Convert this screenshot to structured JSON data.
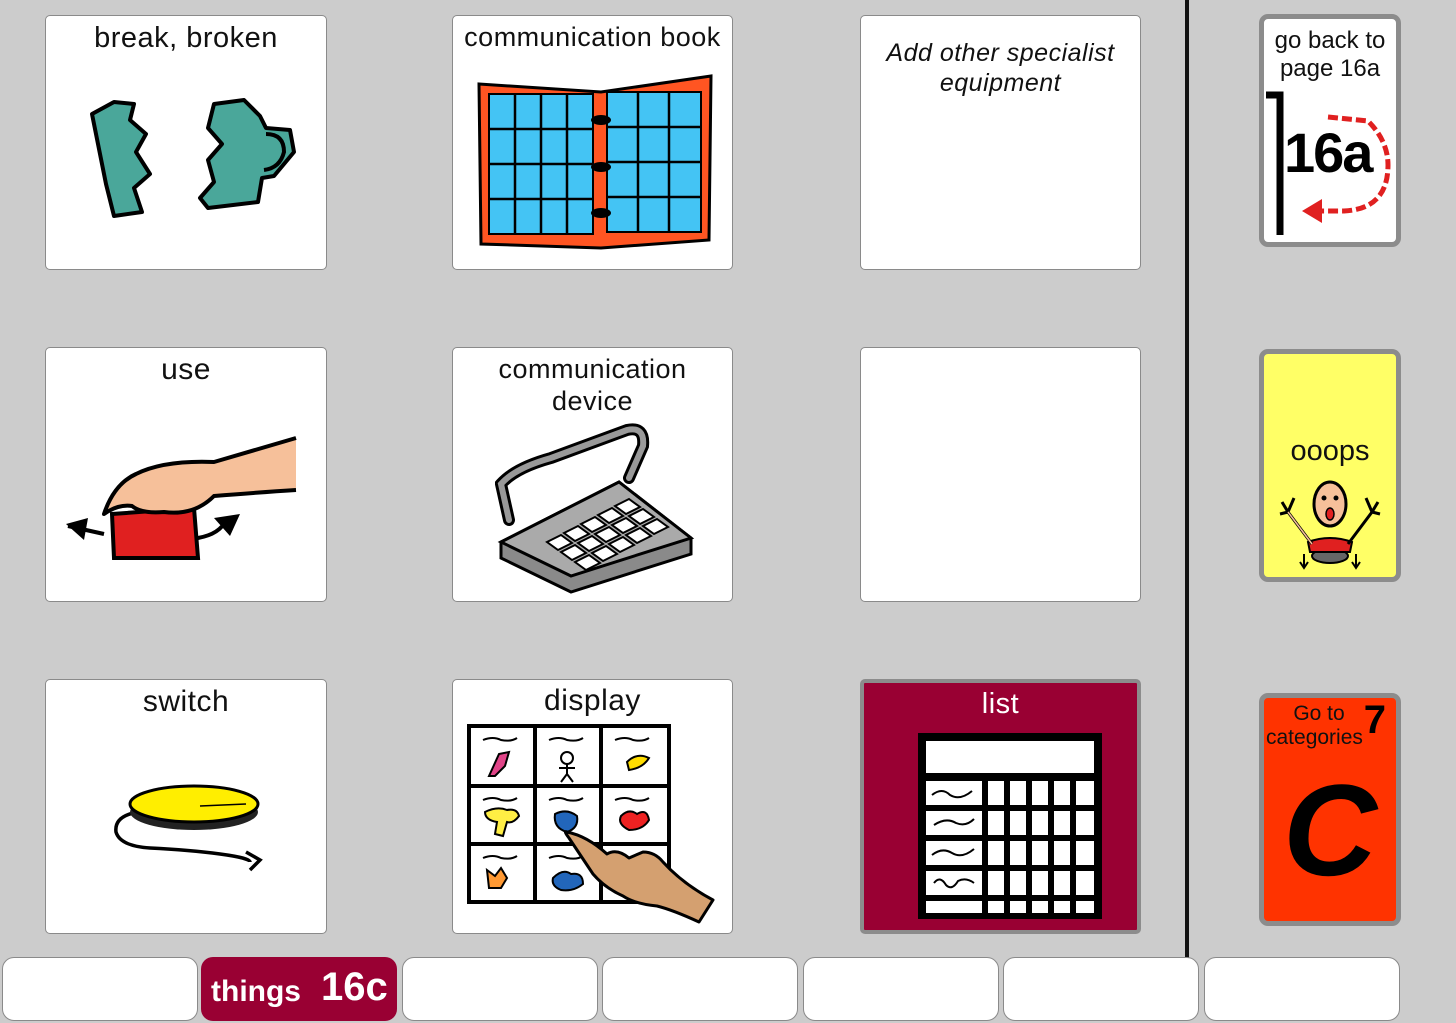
{
  "colors": {
    "background": "#cccccc",
    "maroon": "#990033",
    "oops_yellow": "#ffff66",
    "categories_orange": "#ff3300"
  },
  "grid": {
    "break": {
      "label": "break,  broken",
      "icon": "broken-cup-icon"
    },
    "communication_book": {
      "label": "communication book",
      "icon": "communication-book-icon"
    },
    "specialist": {
      "label_line1": "Add other specialist",
      "label_line2": "equipment"
    },
    "use": {
      "label": "use",
      "icon": "hand-pressing-button-icon"
    },
    "communication_device": {
      "label_line1": "communication",
      "label_line2": "device",
      "icon": "keyboard-device-icon"
    },
    "switch": {
      "label": "switch",
      "icon": "switch-icon"
    },
    "display": {
      "label": "display",
      "icon": "symbol-display-icon"
    },
    "list": {
      "label": "list",
      "icon": "list-table-icon"
    }
  },
  "nav": {
    "go_back": {
      "label_line1": "go back to",
      "label_line2": "page 16a",
      "page_code": "16a"
    },
    "oops": {
      "label": "ooops",
      "icon": "oops-person-icon"
    },
    "categories": {
      "label_line1": "Go to",
      "label_line2": "categories",
      "number": "7",
      "letter": "C"
    }
  },
  "tabs": {
    "active_label": "things",
    "active_code": "16c"
  }
}
